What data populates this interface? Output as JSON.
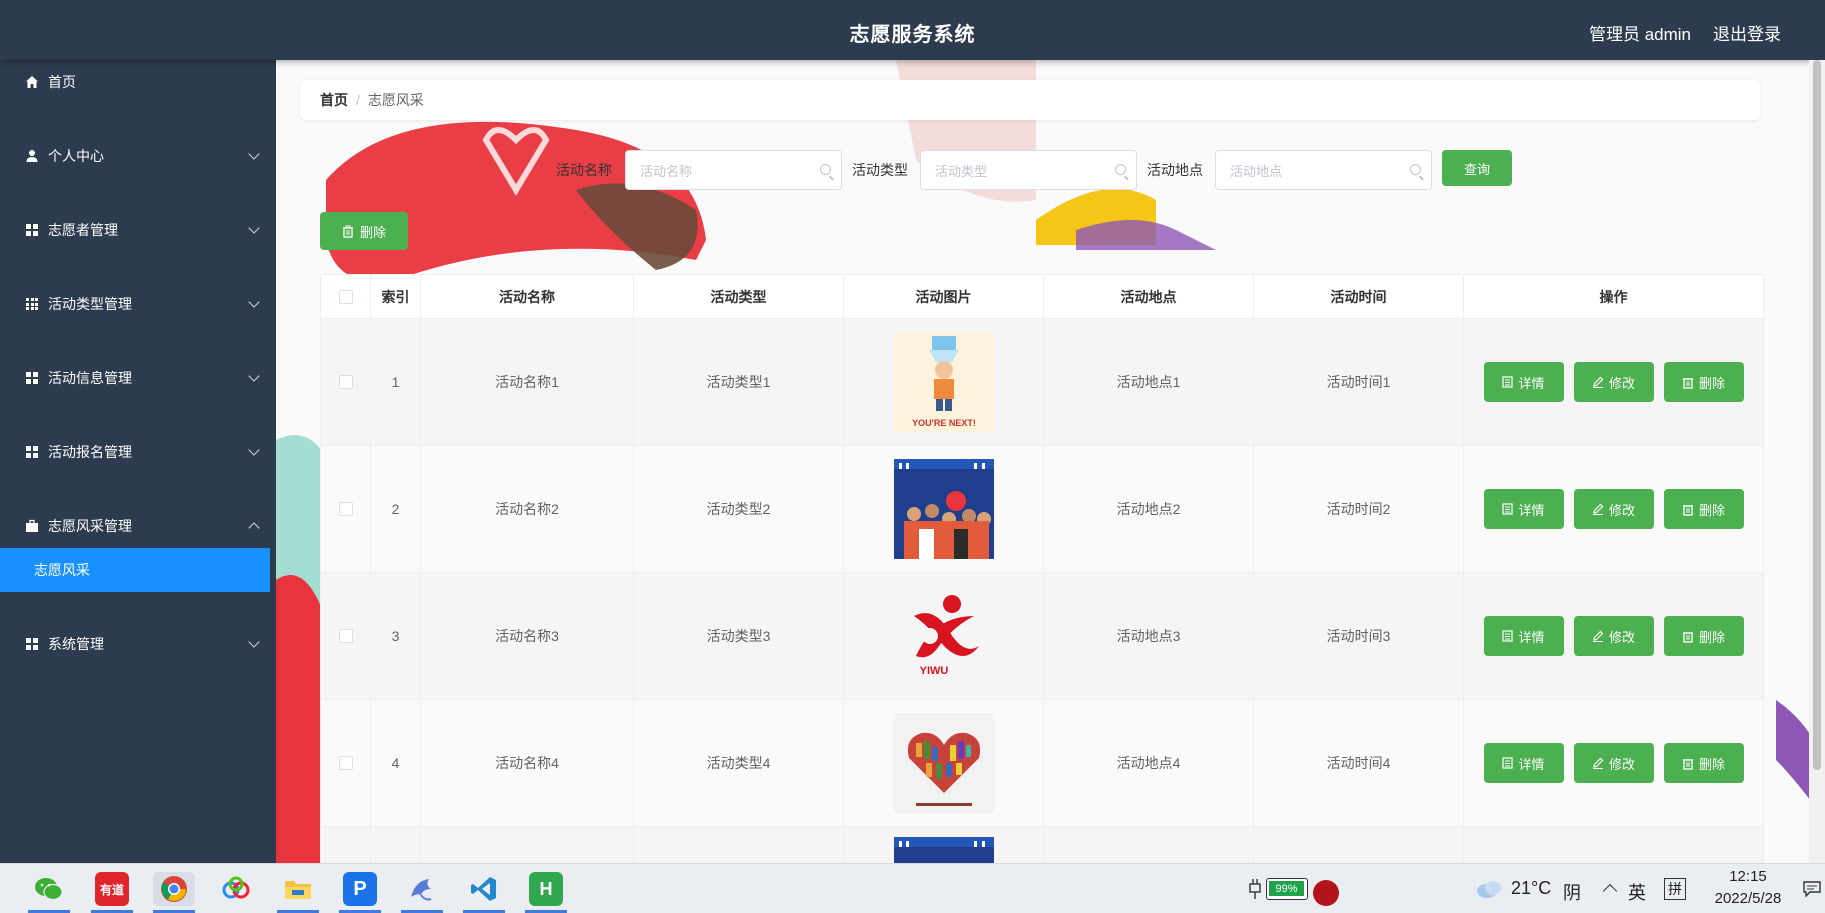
{
  "header": {
    "title": "志愿服务系统",
    "admin": "管理员 admin",
    "logout": "退出登录"
  },
  "sidebar": {
    "items": [
      {
        "label": "首页"
      },
      {
        "label": "个人中心"
      },
      {
        "label": "志愿者管理"
      },
      {
        "label": "活动类型管理"
      },
      {
        "label": "活动信息管理"
      },
      {
        "label": "活动报名管理"
      },
      {
        "label": "志愿风采管理"
      },
      {
        "label": "系统管理"
      }
    ],
    "active_sub": "志愿风采"
  },
  "breadcrumb": {
    "home": "首页",
    "sep": "/",
    "current": "志愿风采"
  },
  "search": {
    "name_label": "活动名称",
    "name_placeholder": "活动名称",
    "type_label": "活动类型",
    "type_placeholder": "活动类型",
    "place_label": "活动地点",
    "place_placeholder": "活动地点",
    "query": "查询"
  },
  "toolbar": {
    "delete": "删除"
  },
  "table": {
    "headers": [
      "",
      "索引",
      "活动名称",
      "活动类型",
      "活动图片",
      "活动地点",
      "活动时间",
      "操作"
    ],
    "rows": [
      {
        "index": "1",
        "name": "活动名称1",
        "type": "活动类型1",
        "place": "活动地点1",
        "time": "活动时间1",
        "image": "ice-bucket-challenge-image"
      },
      {
        "index": "2",
        "name": "活动名称2",
        "type": "活动类型2",
        "place": "活动地点2",
        "time": "活动时间2",
        "image": "volunteer-group-photo"
      },
      {
        "index": "3",
        "name": "活动名称3",
        "type": "活动类型3",
        "place": "活动地点3",
        "time": "活动时间3",
        "image": "yiwu-logo"
      },
      {
        "index": "4",
        "name": "活动名称4",
        "type": "活动类型4",
        "place": "活动地点4",
        "time": "活动时间4",
        "image": "book-heart-image"
      }
    ],
    "actions": {
      "detail": "详情",
      "edit": "修改",
      "delete": "删除"
    }
  },
  "images": {
    "row1_caption": "YOU'RE NEXT!",
    "row3_caption": "YIWU"
  },
  "taskbar": {
    "apps": [
      "wechat-icon",
      "youdao-icon",
      "chrome-icon",
      "baidu-netdisk-icon",
      "file-explorer-icon",
      "p-app-icon",
      "dolphin-app-icon",
      "vscode-icon",
      "hbuilder-icon"
    ],
    "youdao_label": "有道",
    "battery": "99%",
    "weather_temp": "21°C",
    "weather_desc": "阴",
    "lang1": "英",
    "lang2": "拼",
    "time": "12:15",
    "date": "2022/5/28"
  },
  "colors": {
    "header": "#2c3b4d",
    "accent_blue": "#1890ff",
    "button_green": "#4caf50"
  }
}
